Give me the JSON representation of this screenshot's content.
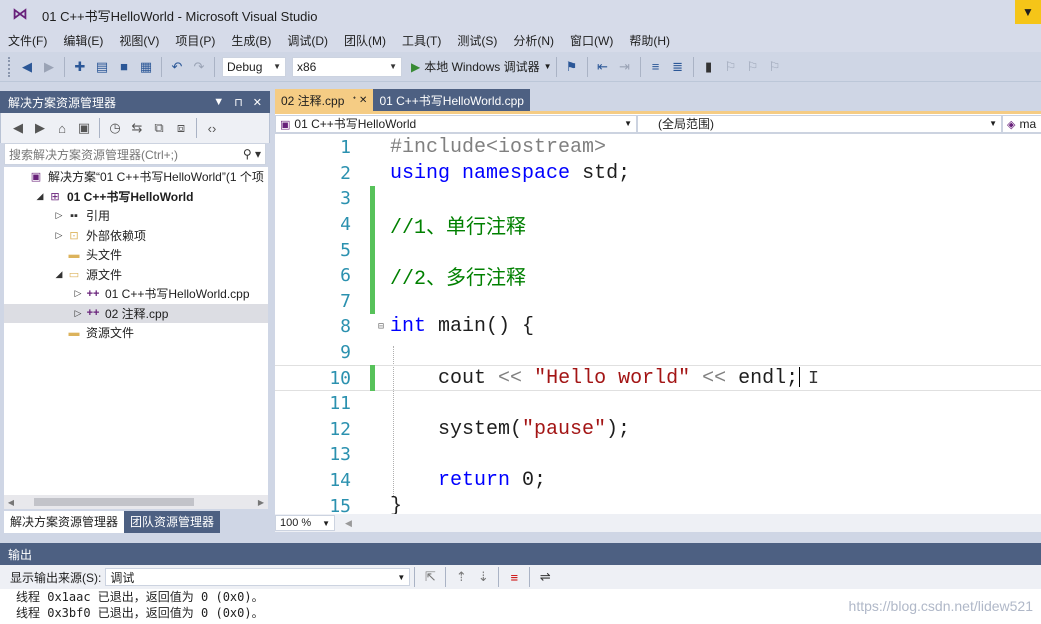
{
  "window": {
    "title": "01 C++书写HelloWorld - Microsoft Visual Studio"
  },
  "menu": [
    "文件(F)",
    "编辑(E)",
    "视图(V)",
    "项目(P)",
    "生成(B)",
    "调试(D)",
    "团队(M)",
    "工具(T)",
    "测试(S)",
    "分析(N)",
    "窗口(W)",
    "帮助(H)"
  ],
  "toolbar": {
    "config": "Debug",
    "platform": "x86",
    "run_label": "本地 Windows 调试器"
  },
  "solution_explorer": {
    "title": "解决方案资源管理器",
    "search_placeholder": "搜索解决方案资源管理器(Ctrl+;)",
    "tree": [
      {
        "label": "解决方案“01 C++书写HelloWorld”(1 个项",
        "icon": "solution-icon",
        "arrow": "",
        "indent": 0,
        "bold": false
      },
      {
        "label": "01 C++书写HelloWorld",
        "icon": "project-icon",
        "arrow": "◢",
        "indent": 1,
        "bold": true
      },
      {
        "label": "引用",
        "icon": "references-icon",
        "arrow": "▷",
        "indent": 2,
        "bold": false
      },
      {
        "label": "外部依赖项",
        "icon": "external-deps-icon",
        "arrow": "▷",
        "indent": 2,
        "bold": false
      },
      {
        "label": "头文件",
        "icon": "folder-icon",
        "arrow": "",
        "indent": 2,
        "bold": false
      },
      {
        "label": "源文件",
        "icon": "folder-open-icon",
        "arrow": "◢",
        "indent": 2,
        "bold": false
      },
      {
        "label": "01 C++书写HelloWorld.cpp",
        "icon": "cpp-file-icon",
        "arrow": "▷",
        "indent": 3,
        "bold": false
      },
      {
        "label": "02 注释.cpp",
        "icon": "cpp-file-icon",
        "arrow": "▷",
        "indent": 3,
        "bold": false,
        "selected": true
      },
      {
        "label": "资源文件",
        "icon": "folder-icon",
        "arrow": "",
        "indent": 2,
        "bold": false
      }
    ],
    "bottom_tabs": [
      "解决方案资源管理器",
      "团队资源管理器"
    ]
  },
  "editor": {
    "tabs": [
      {
        "label": "02 注释.cpp",
        "active": true,
        "pin": "ᐩ ✕"
      },
      {
        "label": "01 C++书写HelloWorld.cpp",
        "active": false
      }
    ],
    "nav": {
      "project": "01 C++书写HelloWorld",
      "scope": "(全局范围)",
      "member": "ma"
    },
    "zoom": "100 %",
    "lines": [
      {
        "n": "1",
        "segs": [
          {
            "c": "pp",
            "t": "#include<iostream>"
          }
        ]
      },
      {
        "n": "2",
        "segs": [
          {
            "c": "kw",
            "t": "using"
          },
          {
            "c": "fn",
            "t": " "
          },
          {
            "c": "kw",
            "t": "namespace"
          },
          {
            "c": "fn",
            "t": " std;"
          }
        ]
      },
      {
        "n": "3",
        "segs": [],
        "changed": true
      },
      {
        "n": "4",
        "segs": [
          {
            "c": "cm",
            "t": "//1、单行注释"
          }
        ],
        "changed": true
      },
      {
        "n": "5",
        "segs": [],
        "changed": true
      },
      {
        "n": "6",
        "segs": [
          {
            "c": "cm",
            "t": "//2、多行注释"
          }
        ],
        "changed": true
      },
      {
        "n": "7",
        "segs": [],
        "changed": true
      },
      {
        "n": "8",
        "segs": [
          {
            "c": "kw",
            "t": "int"
          },
          {
            "c": "fn",
            "t": " main() {"
          }
        ],
        "fold": "⊟"
      },
      {
        "n": "9",
        "segs": []
      },
      {
        "n": "10",
        "segs": [
          {
            "c": "fn",
            "t": "    cout "
          },
          {
            "c": "pp",
            "t": "<<"
          },
          {
            "c": "fn",
            "t": " "
          },
          {
            "c": "st",
            "t": "\"Hello world\""
          },
          {
            "c": "fn",
            "t": " "
          },
          {
            "c": "pp",
            "t": "<<"
          },
          {
            "c": "fn",
            "t": " endl;"
          }
        ],
        "changed": true,
        "caret": true
      },
      {
        "n": "11",
        "segs": []
      },
      {
        "n": "12",
        "segs": [
          {
            "c": "fn",
            "t": "    system("
          },
          {
            "c": "st",
            "t": "\"pause\""
          },
          {
            "c": "fn",
            "t": ");"
          }
        ]
      },
      {
        "n": "13",
        "segs": []
      },
      {
        "n": "14",
        "segs": [
          {
            "c": "fn",
            "t": "    "
          },
          {
            "c": "kw",
            "t": "return"
          },
          {
            "c": "fn",
            "t": " 0;"
          }
        ]
      },
      {
        "n": "15",
        "segs": [
          {
            "c": "fn",
            "t": "}"
          }
        ]
      }
    ]
  },
  "output": {
    "title": "输出",
    "source_label": "显示输出来源(S):",
    "source_value": "调试",
    "lines": [
      "线程 0x1aac 已退出，返回值为 0 (0x0)。",
      "线程 0x3bf0 已退出，返回值为 0 (0x0)。"
    ]
  },
  "watermark": "https://blog.csdn.net/lidew521"
}
